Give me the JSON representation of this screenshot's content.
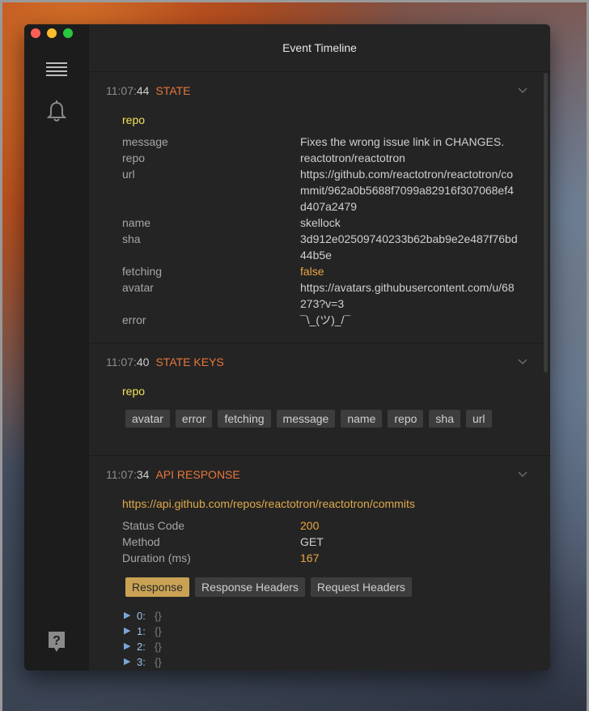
{
  "window": {
    "title": "Event Timeline"
  },
  "events": [
    {
      "time_hm": "11:07:",
      "time_s": "44",
      "type": "STATE",
      "subtitle": "repo",
      "rows": [
        {
          "key": "message",
          "val": "Fixes the wrong issue link in CHANGES."
        },
        {
          "key": "repo",
          "val": "reactotron/reactotron"
        },
        {
          "key": "url",
          "val": "https://github.com/reactotron/reactotron/commit/962a0b5688f7099a82916f307068ef4d407a2479"
        },
        {
          "key": "name",
          "val": "skellock"
        },
        {
          "key": "sha",
          "val": "3d912e02509740233b62bab9e2e487f76bd44b5e"
        },
        {
          "key": "fetching",
          "val": "false"
        },
        {
          "key": "avatar",
          "val": "https://avatars.githubusercontent.com/u/68273?v=3"
        },
        {
          "key": "error",
          "val": "¯\\_(ツ)_/¯"
        }
      ]
    },
    {
      "time_hm": "11:07:",
      "time_s": "40",
      "type": "STATE KEYS",
      "subtitle": "repo",
      "chips": [
        "avatar",
        "error",
        "fetching",
        "message",
        "name",
        "repo",
        "sha",
        "url"
      ]
    },
    {
      "time_hm": "11:07:",
      "time_s": "34",
      "type": "API RESPONSE",
      "url": "https://api.github.com/repos/reactotron/reactotron/commits",
      "rows": [
        {
          "key": "Status Code",
          "val": "200"
        },
        {
          "key": "Method",
          "val": "GET"
        },
        {
          "key": "Duration (ms)",
          "val": "167"
        }
      ],
      "tabs": [
        "Response",
        "Response Headers",
        "Request Headers"
      ],
      "tree": [
        {
          "key": "0:",
          "val": "{}"
        },
        {
          "key": "1:",
          "val": "{}"
        },
        {
          "key": "2:",
          "val": "{}"
        },
        {
          "key": "3:",
          "val": "{}"
        }
      ]
    }
  ],
  "icons": {
    "timeline": "hamburger-icon",
    "subscriptions": "bell-icon",
    "help": "help-icon",
    "collapse": "chevron-down-icon",
    "expand": "triangle-right-icon"
  },
  "colors": {
    "accent": "#e8763c",
    "subtitle": "#f2e05a",
    "value_highlight": "#e9a443",
    "tab_active": "#c9a253"
  }
}
